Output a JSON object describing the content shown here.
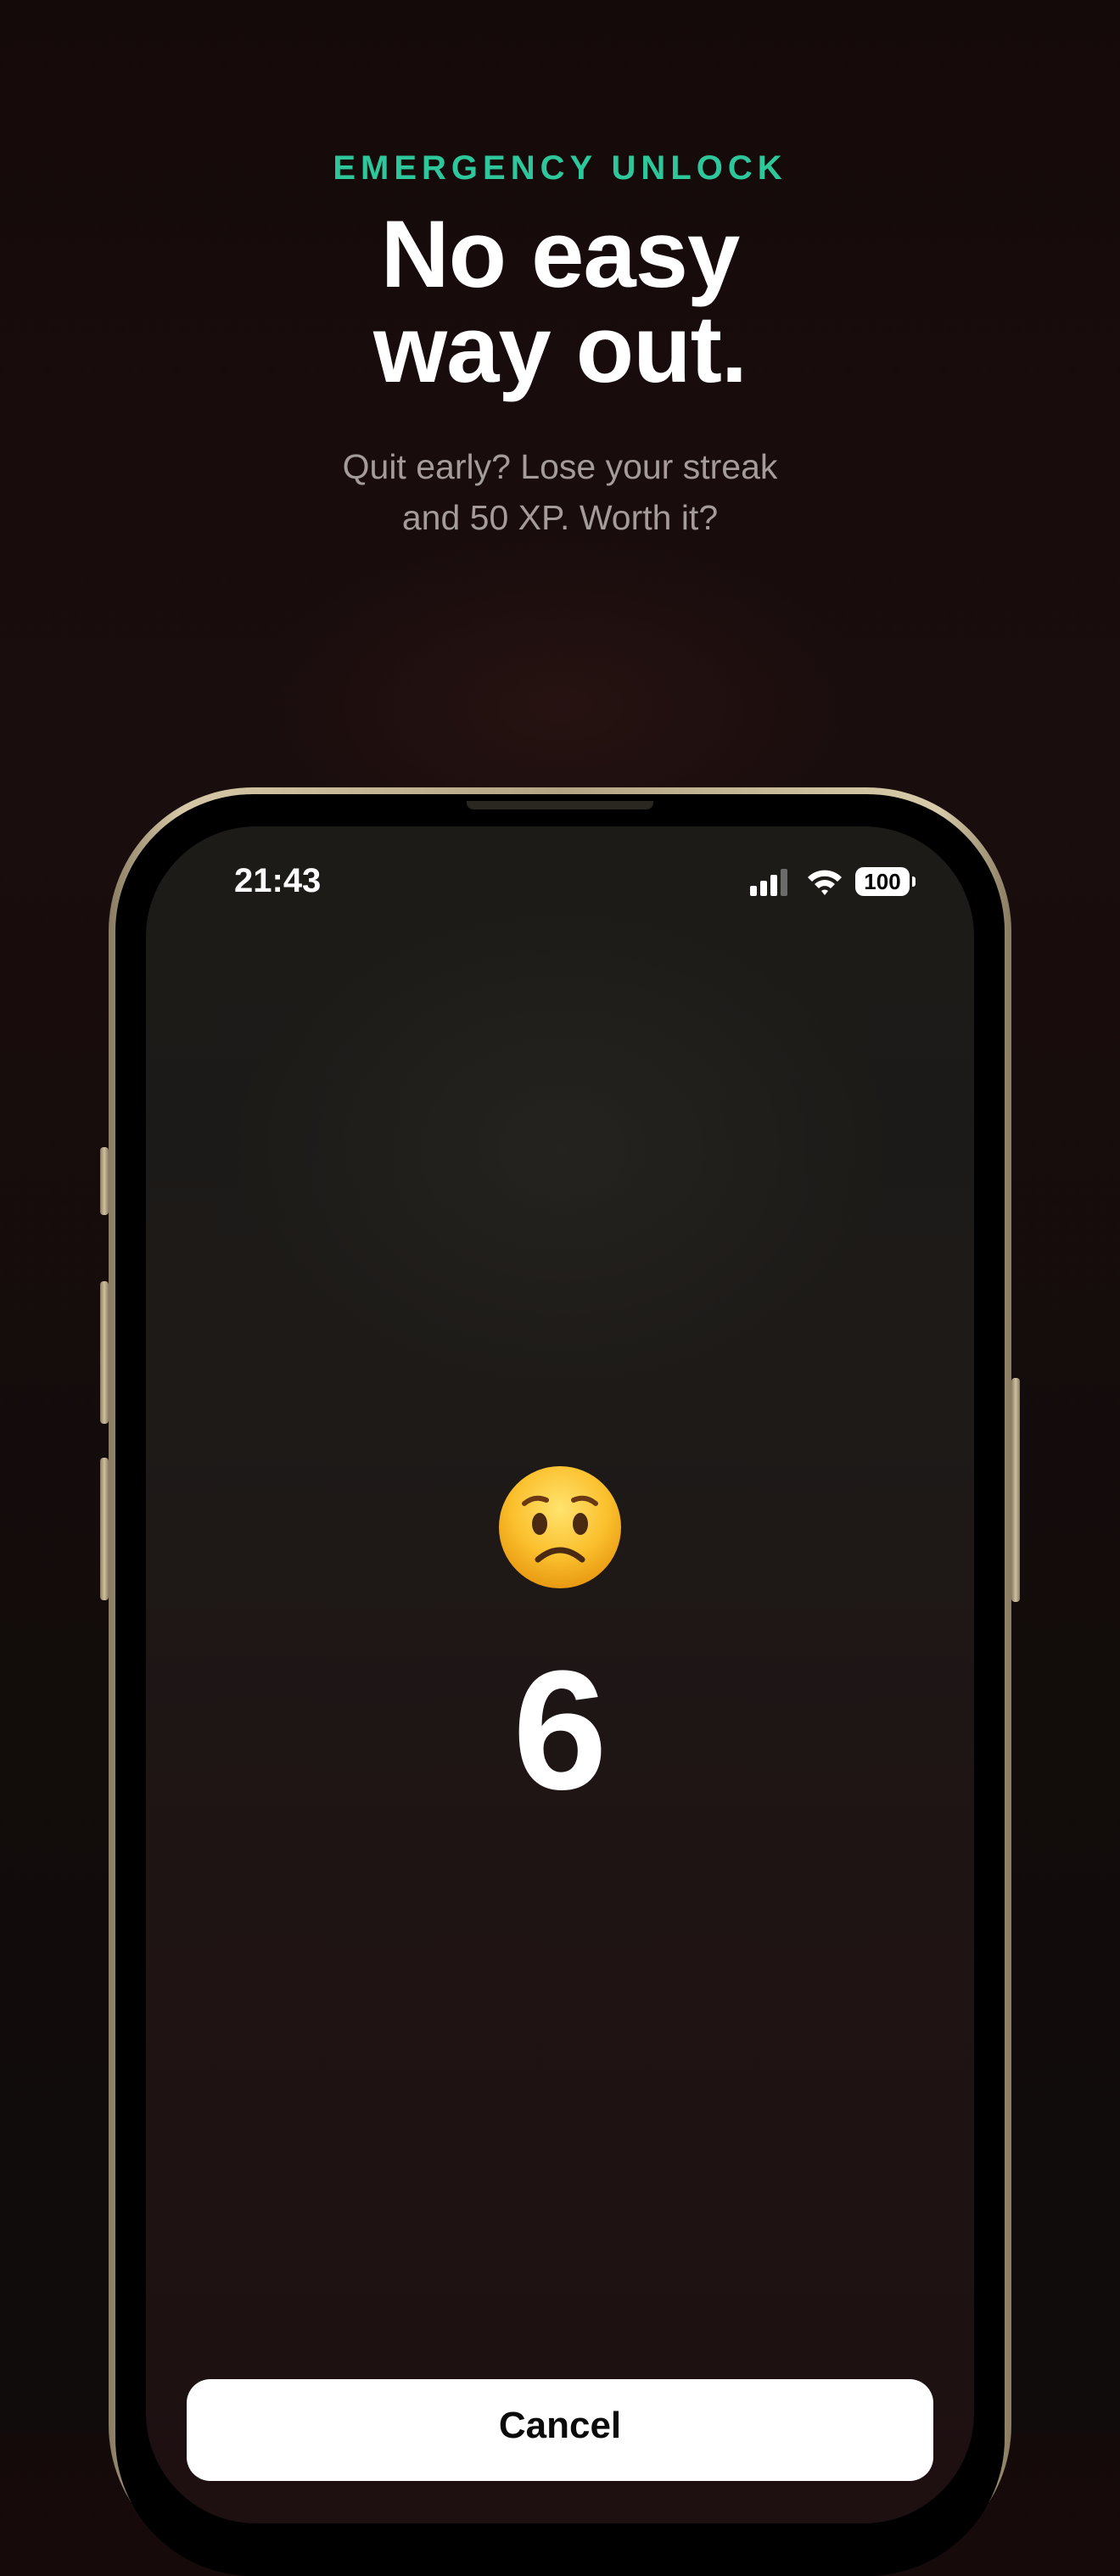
{
  "header": {
    "eyebrow": "EMERGENCY UNLOCK",
    "headline_line1": "No easy",
    "headline_line2": "way out.",
    "subtitle_line1": "Quit early? Lose your streak",
    "subtitle_line2": "and 50 XP. Worth it?"
  },
  "status_bar": {
    "time": "21:43",
    "battery": "100",
    "icons": [
      "signal-icon",
      "wifi-icon",
      "battery-icon"
    ]
  },
  "screen": {
    "emoji_icon": "worried-face-icon",
    "countdown": "6",
    "cancel_label": "Cancel"
  },
  "colors": {
    "accent": "#2ec79b",
    "background": "#150a0a",
    "frame": "#c7b893",
    "button": "#ffffff"
  }
}
